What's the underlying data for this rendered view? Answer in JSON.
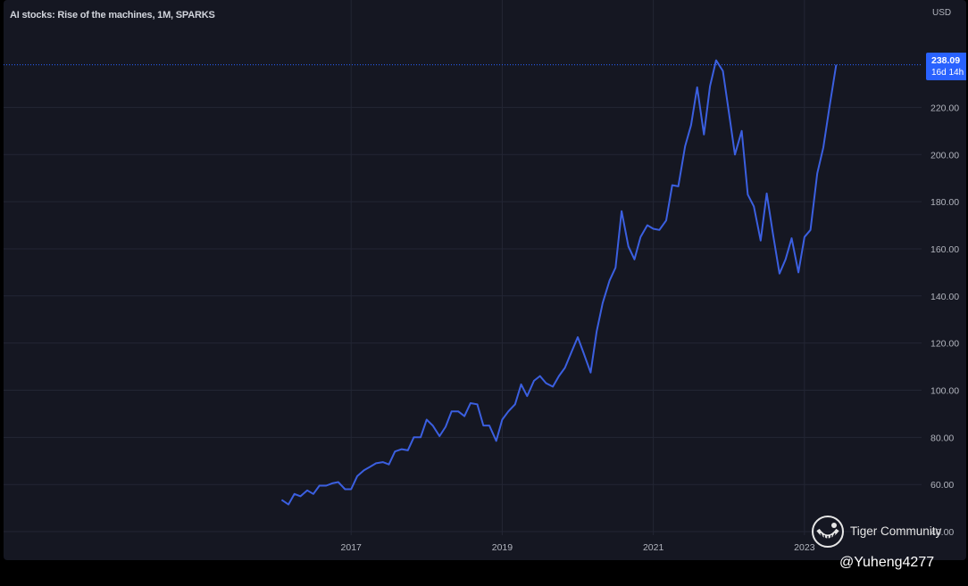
{
  "header": {
    "title": "AI stocks: Rise of the machines, 1M, SPARKS",
    "currency": "USD"
  },
  "price_badge": {
    "price": "238.09",
    "countdown": "16d 14h"
  },
  "watermark": {
    "brand": "Tiger Community",
    "logo_icon": "tiger-logo-icon"
  },
  "user": {
    "handle": "@Yuheng4277"
  },
  "colors": {
    "background": "#151722",
    "line": "#3b5fe0",
    "grid": "#232634",
    "axis_text": "#b2b5be",
    "badge": "#2962ff"
  },
  "chart_data": {
    "type": "line",
    "title": "AI stocks: Rise of the machines, 1M, SPARKS",
    "xlabel": "",
    "ylabel": "",
    "y_unit": "USD",
    "ylim": [
      38.5,
      258
    ],
    "y_ticks": [
      40,
      60,
      80,
      100,
      120,
      140,
      160,
      180,
      200,
      220
    ],
    "y_tick_labels": [
      "40.00",
      "60.00",
      "80.00",
      "100.00",
      "120.00",
      "140.00",
      "160.00",
      "180.00",
      "200.00",
      "220.00"
    ],
    "x_ticks": [
      2017,
      2019,
      2021,
      2023
    ],
    "x_tick_labels": [
      "2017",
      "2019",
      "2021",
      "2023"
    ],
    "xlim": [
      2012.4,
      2024.55
    ],
    "grid": true,
    "current_price": 238.09,
    "series": [
      {
        "x": [
          2016.08,
          2016.17,
          2016.25,
          2016.33,
          2016.42,
          2016.5,
          2016.58,
          2016.67,
          2016.75,
          2016.83,
          2016.92,
          2017.0,
          2017.08,
          2017.17,
          2017.25,
          2017.33,
          2017.42,
          2017.5,
          2017.58,
          2017.67,
          2017.75,
          2017.83,
          2017.92,
          2018.0,
          2018.08,
          2018.17,
          2018.25,
          2018.33,
          2018.42,
          2018.5,
          2018.58,
          2018.67,
          2018.75,
          2018.83,
          2018.92,
          2019.0,
          2019.08,
          2019.17,
          2019.25,
          2019.33,
          2019.42,
          2019.5,
          2019.58,
          2019.67,
          2019.75,
          2019.83,
          2019.92,
          2020.0,
          2020.08,
          2020.17,
          2020.25,
          2020.33,
          2020.42,
          2020.5,
          2020.58,
          2020.67,
          2020.75,
          2020.83,
          2020.92,
          2021.0,
          2021.08,
          2021.17,
          2021.25,
          2021.33,
          2021.42,
          2021.5,
          2021.58,
          2021.67,
          2021.75,
          2021.83,
          2021.92,
          2022.0,
          2022.08,
          2022.17,
          2022.25,
          2022.33,
          2022.42,
          2022.5,
          2022.58,
          2022.67,
          2022.75,
          2022.83,
          2022.92,
          2023.0,
          2023.08,
          2023.17,
          2023.25,
          2023.33,
          2023.42
        ],
        "y": [
          53.5,
          51.5,
          56.0,
          55.0,
          57.5,
          56.0,
          59.5,
          59.5,
          60.5,
          61.0,
          58.0,
          58.0,
          63.5,
          66.0,
          67.5,
          69.0,
          69.5,
          68.5,
          74.0,
          75.0,
          74.5,
          80.0,
          80.0,
          87.5,
          85.0,
          80.5,
          84.5,
          91.0,
          91.0,
          89.0,
          94.5,
          94.0,
          85.0,
          85.0,
          78.5,
          87.5,
          91.0,
          94.0,
          102.5,
          97.5,
          104.0,
          106.0,
          103.0,
          101.5,
          106.0,
          109.5,
          116.5,
          122.5,
          115.5,
          107.5,
          125.0,
          137.0,
          146.5,
          152.0,
          176.0,
          161.0,
          155.5,
          165.0,
          170.0,
          168.5,
          168.0,
          172.0,
          187.0,
          186.5,
          203.5,
          212.5,
          228.5,
          208.5,
          229.0,
          240.0,
          235.5,
          218.0,
          200.0,
          210.0,
          183.0,
          178.0,
          163.5,
          183.5,
          167.0,
          149.5,
          155.5,
          164.5,
          150.0,
          165.0,
          168.0,
          192.0,
          203.0,
          220.0,
          238.09
        ]
      }
    ]
  }
}
